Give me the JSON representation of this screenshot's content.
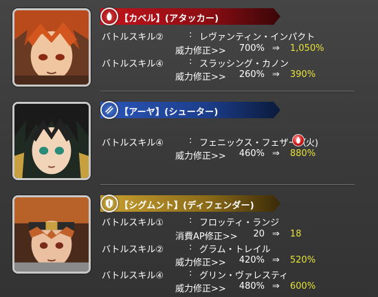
{
  "characters": [
    {
      "banner": "【カベル】(アタッカー)",
      "banner_color": "#b3151c",
      "rows": [
        {
          "label": "バトルスキル②",
          "colon": ":",
          "skill": "レヴァンティン・インパクト"
        },
        {
          "mod_label": "威力修正>>",
          "before": "700%",
          "arrow": "⇒",
          "after": "1,050%"
        },
        {
          "label": "バトルスキル④",
          "colon": ":",
          "skill": "スラッシング・カノン"
        },
        {
          "mod_label": "威力修正>>",
          "before": "260%",
          "arrow": "⇒",
          "after": "390%"
        }
      ]
    },
    {
      "banner": "【アーヤ】(シューター)",
      "banner_color": "#1c3d8a",
      "rows": [
        {
          "label": "バトルスキル④",
          "colon": ":",
          "skill": "フェニックス・フェザー（",
          "skill_suffix": "火)"
        },
        {
          "mod_label": "威力修正>>",
          "before": "460%",
          "arrow": "⇒",
          "after": "880%"
        }
      ]
    },
    {
      "banner": "【シグムント】(ディフェンダー)",
      "banner_color": "#a8861e",
      "rows": [
        {
          "label": "バトルスキル①",
          "colon": ":",
          "skill": "フロッティ・ランジ"
        },
        {
          "mod_label": "消費AP修正>>",
          "before": "20",
          "arrow": "⇒",
          "after": "18"
        },
        {
          "label": "バトルスキル②",
          "colon": ":",
          "skill": "グラム・トレイル"
        },
        {
          "mod_label": "威力修正>>",
          "before": "420%",
          "arrow": "⇒",
          "after": "520%"
        },
        {
          "label": "バトルスキル④",
          "colon": ":",
          "skill": "グリン・ヴァレスティ"
        },
        {
          "mod_label": "威力修正>>",
          "before": "480%",
          "arrow": "⇒",
          "after": "600%"
        }
      ]
    }
  ],
  "icons": {
    "attacker": "flame-emblem-icon",
    "shooter": "bow-emblem-icon",
    "defender": "shield-emblem-icon",
    "fire": "fire-element-icon"
  },
  "colors": {
    "highlight": "#e6e23a",
    "background": "#3d3d3d"
  }
}
